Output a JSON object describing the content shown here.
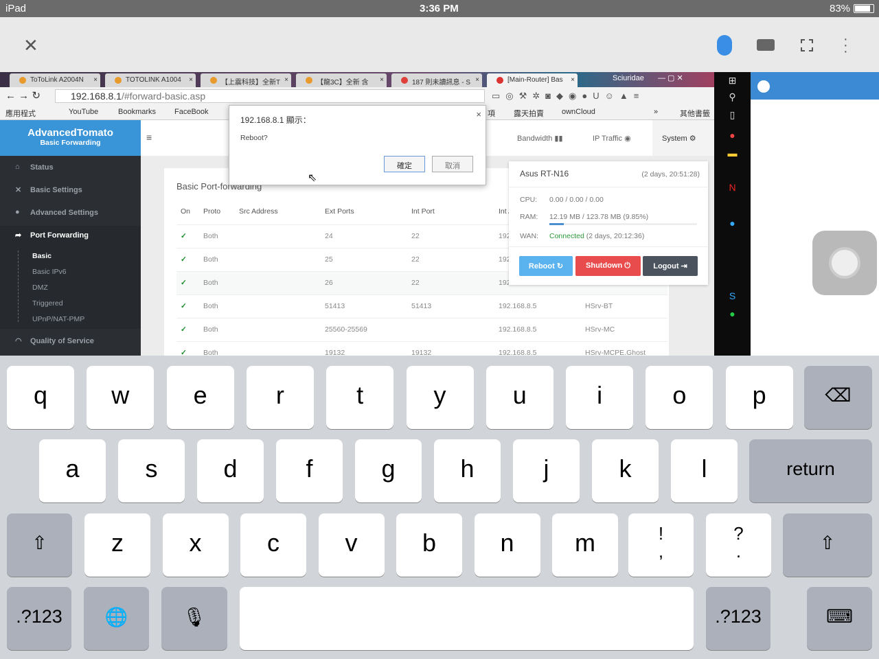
{
  "status_bar": {
    "device": "iPad",
    "time": "3:36 PM",
    "battery": "83%"
  },
  "toolbar": {
    "close": "✕",
    "mouse_color": "#3a8ee6"
  },
  "browser": {
    "tabs": [
      {
        "title": "ToToLink A2004N"
      },
      {
        "title": "TOTOLINK A1004"
      },
      {
        "title": "【上震科技】全新T"
      },
      {
        "title": "【龍3C】全新 含"
      },
      {
        "title": "187 則未讀訊息 - S"
      },
      {
        "title": "[Main-Router] Bas"
      }
    ],
    "window_title": "Sciuridae",
    "url_host": "192.168.8.1",
    "url_path": "/#forward-basic.asp",
    "bookmarks": [
      "應用程式",
      "YouTube",
      "Bookmarks",
      "FaceBook",
      "項",
      "露天拍賣",
      "ownCloud",
      "»",
      "其他書籤"
    ]
  },
  "router": {
    "brand": "AdvancedTomato",
    "subtitle": "Basic Forwarding",
    "nav": [
      {
        "label": "Status",
        "icon": "⌂"
      },
      {
        "label": "Basic Settings",
        "icon": "✕"
      },
      {
        "label": "Advanced Settings",
        "icon": "●"
      },
      {
        "label": "Port Forwarding",
        "icon": "➦"
      },
      {
        "label": "Quality of Service",
        "icon": "◠"
      }
    ],
    "subnav": [
      "Basic",
      "Basic IPv6",
      "DMZ",
      "Triggered",
      "UPnP/NAT-PMP"
    ],
    "topnav": {
      "bandwidth": "Bandwidth",
      "ip_traffic": "IP Traffic",
      "system": "System"
    },
    "page_title": "Basic Port-forwarding",
    "columns": [
      "On",
      "Proto",
      "Src Address",
      "Ext Ports",
      "Int Port",
      "Int Address",
      "Description"
    ],
    "rows": [
      {
        "on": "✓",
        "proto": "Both",
        "src": "",
        "ext": "24",
        "int": "22",
        "addr": "192.168.8.5",
        "desc": ""
      },
      {
        "on": "✓",
        "proto": "Both",
        "src": "",
        "ext": "25",
        "int": "22",
        "addr": "192.168.8.5",
        "desc": ""
      },
      {
        "on": "✓",
        "proto": "Both",
        "src": "",
        "ext": "26",
        "int": "22",
        "addr": "192.168.8.5",
        "desc": ""
      },
      {
        "on": "✓",
        "proto": "Both",
        "src": "",
        "ext": "51413",
        "int": "51413",
        "addr": "192.168.8.5",
        "desc": "HSrv-BT"
      },
      {
        "on": "✓",
        "proto": "Both",
        "src": "",
        "ext": "25560-25569",
        "int": "",
        "addr": "192.168.8.5",
        "desc": "HSrv-MC"
      },
      {
        "on": "✓",
        "proto": "Both",
        "src": "",
        "ext": "19132",
        "int": "19132",
        "addr": "192.168.8.5",
        "desc": "HSrv-MCPE.Ghost"
      }
    ],
    "system": {
      "model": "Asus RT-N16",
      "uptime": "(2 days, 20:51:28)",
      "cpu_label": "CPU:",
      "cpu": "0.00 / 0.00 / 0.00",
      "ram_label": "RAM:",
      "ram": "12.19 MB / 123.78 MB (9.85%)",
      "ram_percent": 9.85,
      "wan_label": "WAN:",
      "wan_status": "Connected",
      "wan_uptime": "(2 days, 20:12:36)",
      "reboot": "Reboot",
      "shutdown": "Shutdown",
      "logout": "Logout"
    }
  },
  "dialog": {
    "title": "192.168.8.1 顯示：",
    "message": "Reboot?",
    "ok": "確定",
    "cancel": "取消",
    "close": "×"
  },
  "keyboard": {
    "row1": [
      "q",
      "w",
      "e",
      "r",
      "t",
      "y",
      "u",
      "i",
      "o",
      "p"
    ],
    "row2": [
      "a",
      "s",
      "d",
      "f",
      "g",
      "h",
      "j",
      "k",
      "l"
    ],
    "row3": [
      "z",
      "x",
      "c",
      "v",
      "b",
      "n",
      "m"
    ],
    "punct1": "!\n,",
    "punct2": "?\n.",
    "return": "return",
    "numbers": ".?123"
  }
}
